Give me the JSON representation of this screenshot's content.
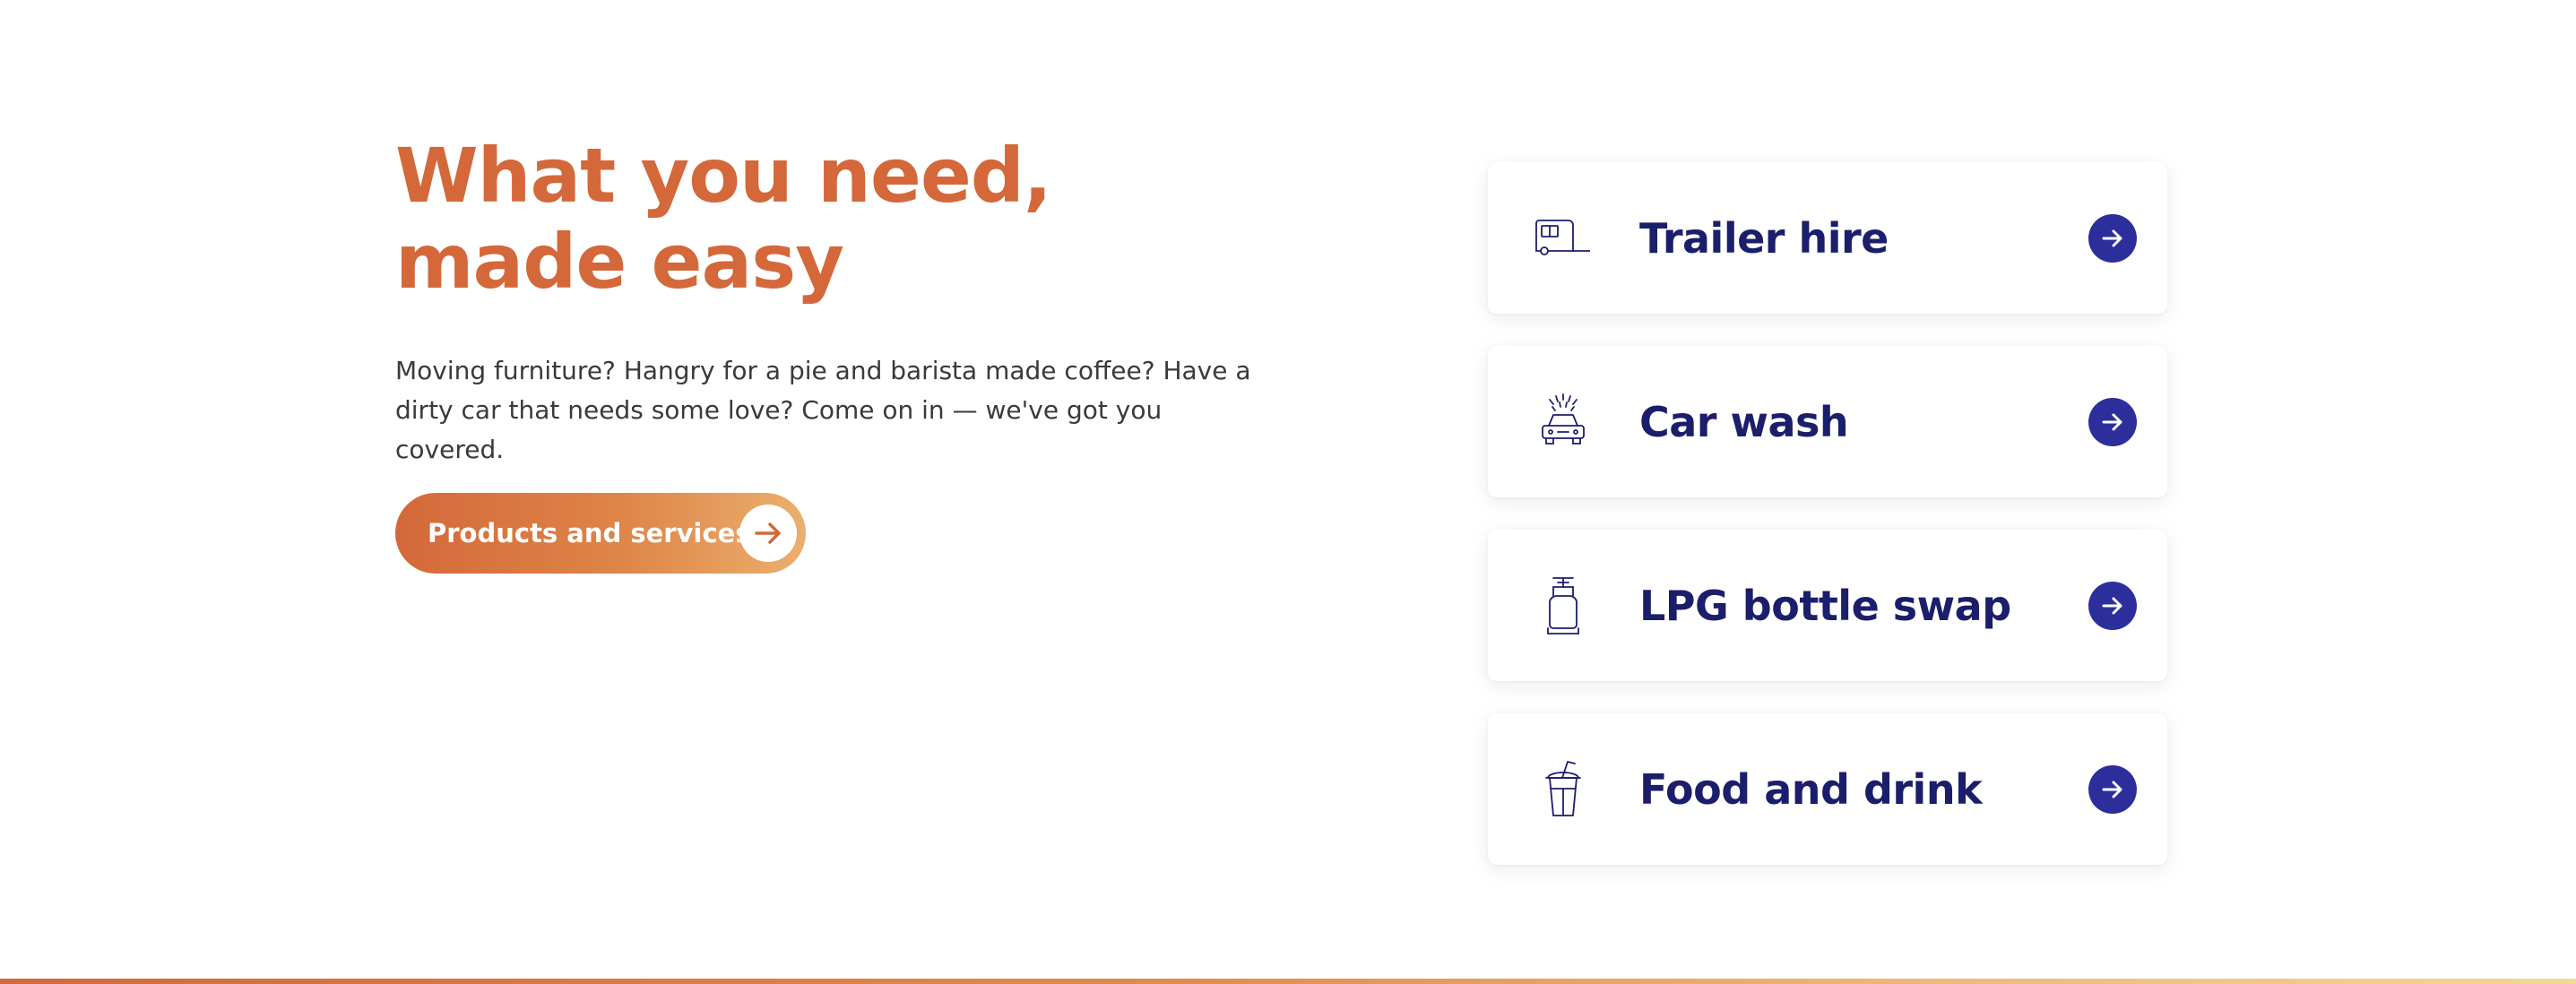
{
  "hero": {
    "title": "What you need, made easy",
    "description": "Moving furniture? Hangry for a pie and barista made coffee? Have a dirty car that needs some love? Come on in — we've got you covered.",
    "cta_label": "Products and services"
  },
  "services": [
    {
      "label": "Trailer hire",
      "icon": "trailer-icon"
    },
    {
      "label": "Car wash",
      "icon": "car-wash-icon"
    },
    {
      "label": "LPG bottle swap",
      "icon": "gas-bottle-icon"
    },
    {
      "label": "Food and drink",
      "icon": "drink-cup-icon"
    }
  ],
  "colors": {
    "accent_orange": "#D4683A",
    "navy": "#1B1E6B",
    "arrow_blue": "#2C2F9B"
  }
}
